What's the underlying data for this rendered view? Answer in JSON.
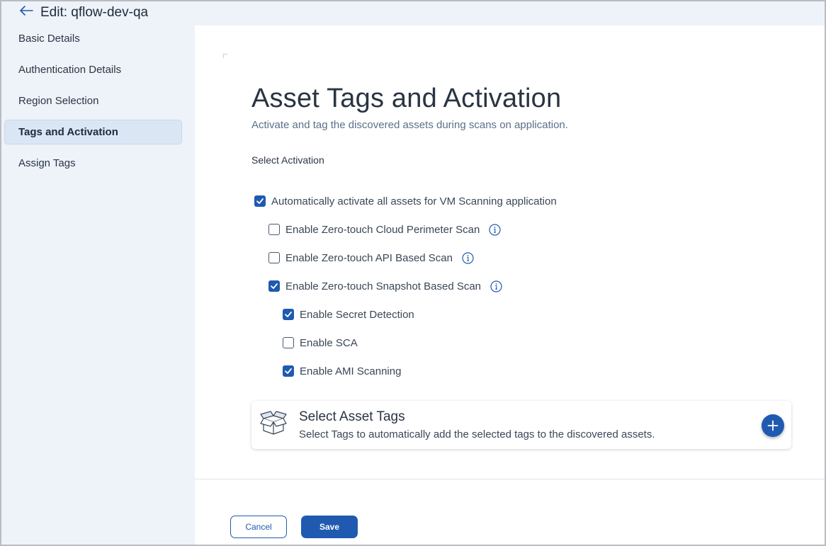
{
  "header": {
    "title": "Edit: qflow-dev-qa",
    "back_icon": "arrow-left-icon"
  },
  "sidebar": {
    "items": [
      {
        "label": "Basic Details",
        "active": false
      },
      {
        "label": "Authentication Details",
        "active": false
      },
      {
        "label": "Region Selection",
        "active": false
      },
      {
        "label": "Tags and Activation",
        "active": true
      },
      {
        "label": "Assign Tags",
        "active": false
      }
    ]
  },
  "main": {
    "heading": "Asset Tags and Activation",
    "subheading": "Activate and tag the discovered assets during scans on application.",
    "section_label": "Select Activation",
    "options": [
      {
        "label": "Automatically activate all assets for VM Scanning application",
        "checked": true,
        "info": false
      },
      {
        "label": "Enable Zero-touch Cloud Perimeter Scan",
        "checked": false,
        "info": true
      },
      {
        "label": "Enable Zero-touch API Based Scan",
        "checked": false,
        "info": true
      },
      {
        "label": "Enable Zero-touch Snapshot Based Scan",
        "checked": true,
        "info": true
      },
      {
        "label": "Enable Secret Detection",
        "checked": true,
        "info": false
      },
      {
        "label": "Enable SCA",
        "checked": false,
        "info": false
      },
      {
        "label": "Enable AMI Scanning",
        "checked": true,
        "info": false
      }
    ],
    "tags_card": {
      "icon": "open-box-icon",
      "title": "Select Asset Tags",
      "description": "Select Tags to automatically add the selected tags to the discovered assets.",
      "add_icon": "plus-icon"
    }
  },
  "footer": {
    "cancel_label": "Cancel",
    "save_label": "Save"
  },
  "colors": {
    "accent": "#1f5ab0",
    "sidebar_bg": "#eef2f9",
    "active_nav_bg": "#dbe6f5"
  }
}
